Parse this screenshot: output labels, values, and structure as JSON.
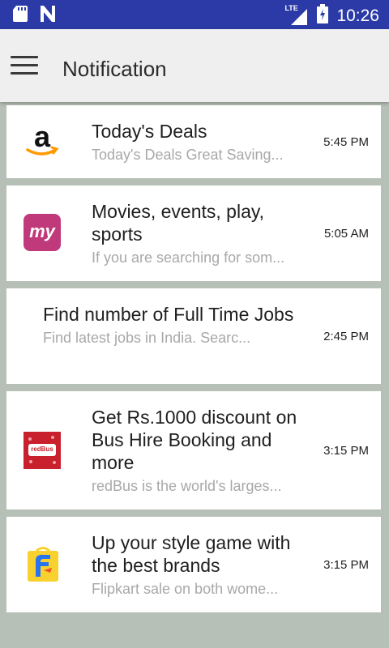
{
  "status_bar": {
    "network_type": "LTE",
    "time": "10:26"
  },
  "app_bar": {
    "title": "Notification"
  },
  "notifications": [
    {
      "icon": "amazon-logo-icon",
      "title": "Today's Deals",
      "subtitle": "Today's Deals Great Saving...",
      "time": "5:45 PM"
    },
    {
      "icon": "bookmyshow-logo-icon",
      "logo_text": "my",
      "title": "Movies, events, play, sports",
      "subtitle": "If you are searching for som...",
      "time": "5:05 AM"
    },
    {
      "icon": "",
      "title": "Find number of Full Time Jobs",
      "subtitle": "Find latest jobs in India. Searc...",
      "time": "2:45 PM"
    },
    {
      "icon": "redbus-logo-icon",
      "logo_text": "redBus",
      "title": "Get Rs.1000 discount on Bus Hire Booking and more",
      "subtitle": "redBus is the world's larges...",
      "time": "3:15 PM"
    },
    {
      "icon": "flipkart-logo-icon",
      "title": "Up your style game with the best brands",
      "subtitle": "Flipkart sale on both wome...",
      "time": "3:15 PM"
    }
  ],
  "colors": {
    "status_bar": "#2b3aa6",
    "app_bar": "#efefef",
    "background": "#b7c0b7",
    "amazon_orange": "#f90",
    "bookmyshow": "#c0397a",
    "redbus": "#c8202d",
    "flipkart_yellow": "#f8d12f",
    "flipkart_blue": "#2874f0"
  }
}
